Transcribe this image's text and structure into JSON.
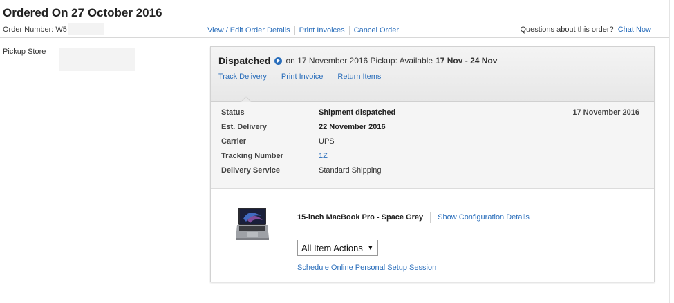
{
  "order": {
    "title": "Ordered On 27 October 2016",
    "number_label": "Order Number: W5"
  },
  "order_links": {
    "view_edit": "View / Edit Order Details",
    "print_invoices": "Print Invoices",
    "cancel": "Cancel Order"
  },
  "help": {
    "question": "Questions about this order?",
    "chat": "Chat Now"
  },
  "pickup": {
    "label": "Pickup Store"
  },
  "shipment": {
    "status_title": "Dispatched",
    "on_text": "on 17 November 2016 Pickup: Available",
    "pickup_range": "17 Nov - 24 Nov",
    "links": {
      "track": "Track Delivery",
      "print_invoice": "Print Invoice",
      "return": "Return Items"
    },
    "details": [
      {
        "label": "Status",
        "value": "Shipment dispatched"
      },
      {
        "label": "Est. Delivery",
        "value": "22 November 2016"
      },
      {
        "label": "Carrier",
        "value": "UPS"
      },
      {
        "label": "Tracking Number",
        "value": "1Z"
      },
      {
        "label": "Delivery Service",
        "value": "Standard Shipping"
      }
    ],
    "status_date": "17 November 2016"
  },
  "product": {
    "name": "15-inch MacBook Pro - Space Grey",
    "config_link": "Show Configuration Details",
    "actions_select": "All Item Actions",
    "setup_link": "Schedule Online Personal Setup Session"
  },
  "icons": {
    "status": "play-circle-icon",
    "caret": "caret-down-icon",
    "product": "macbook-pro-image"
  },
  "colors": {
    "link": "#2a6ebb"
  }
}
